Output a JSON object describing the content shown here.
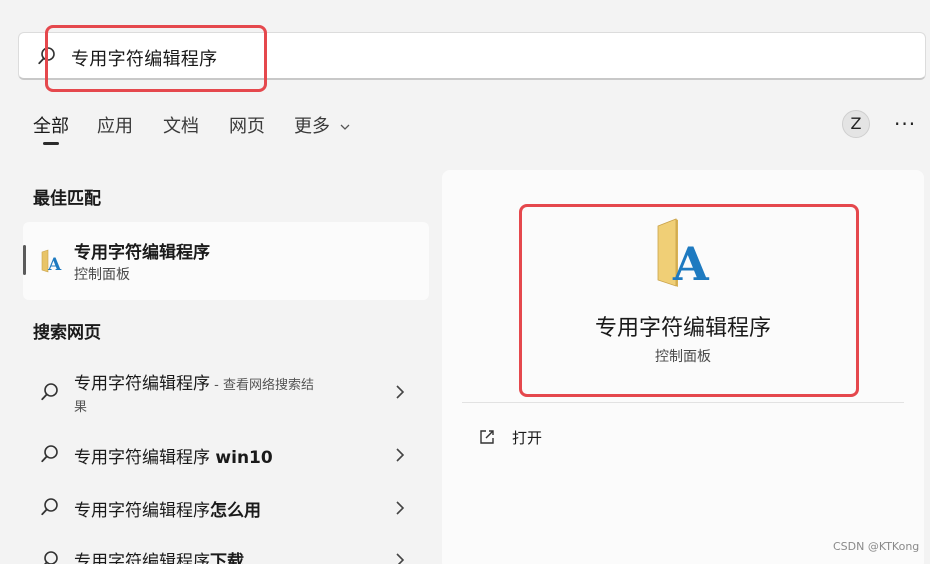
{
  "search": {
    "query": "专用字符编辑程序"
  },
  "tabs": [
    {
      "label": "全部",
      "active": true
    },
    {
      "label": "应用"
    },
    {
      "label": "文档"
    },
    {
      "label": "网页"
    },
    {
      "label": "更多"
    }
  ],
  "header": {
    "avatar_letter": "Z",
    "more_label": "···"
  },
  "best_match": {
    "section_title": "最佳匹配",
    "item": {
      "title": "专用字符编辑程序",
      "subtitle": "控制面板",
      "icon": "font-folder-icon"
    }
  },
  "web_search": {
    "section_title": "搜索网页",
    "items": [
      {
        "query": "专用字符编辑程序",
        "suffix": " - 查看网络搜索结",
        "suffix2": "果"
      },
      {
        "query": "专用字符编辑程序 ",
        "bold": "win10"
      },
      {
        "query": "专用字符编辑程序",
        "bold": "怎么用"
      },
      {
        "query": "专用字符编辑程序",
        "bold": "下载"
      }
    ]
  },
  "preview": {
    "title": "专用字符编辑程序",
    "subtitle": "控制面板",
    "actions": [
      {
        "label": "打开",
        "icon": "open-external-icon"
      }
    ]
  },
  "watermark": "CSDN @KTKong",
  "colors": {
    "highlight": "#e5484d",
    "background": "#f3f3f3",
    "card": "#fbfbfb"
  }
}
